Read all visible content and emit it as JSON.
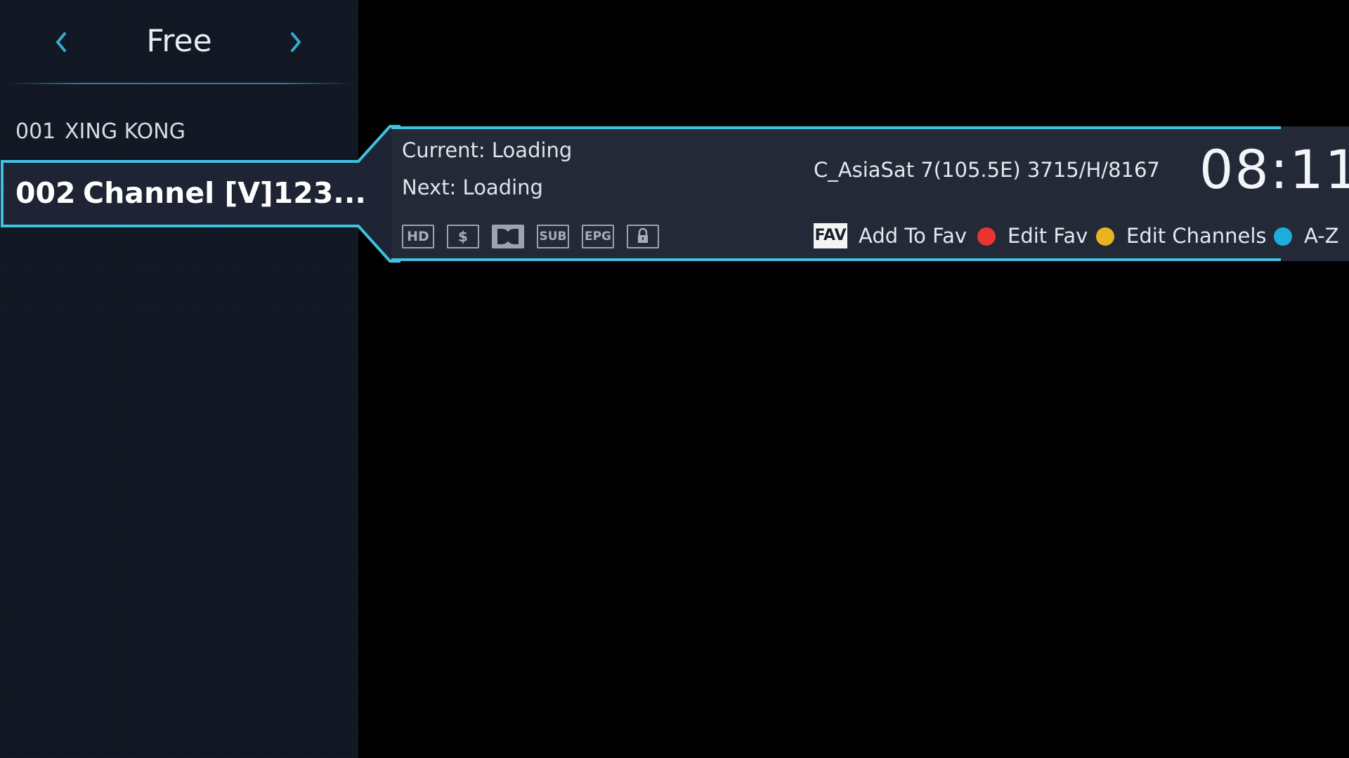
{
  "channel_list": {
    "group_title": "Free",
    "prev_icon": "chevron-left-icon",
    "next_icon": "chevron-right-icon",
    "channels": [
      {
        "number": "001",
        "name": "XING KONG"
      },
      {
        "number": "002",
        "name": "Channel [V]123..."
      }
    ],
    "selected_index": 1
  },
  "info_banner": {
    "current": "Current: Loading",
    "next": "Next: Loading",
    "satellite": "C_AsiaSat 7(105.5E) 3715/H/8167",
    "clock": "08:11",
    "badges": {
      "hd": "HD",
      "scrambled": "$",
      "dolby": "dolby-icon",
      "sub": "SUB",
      "epg": "EPG",
      "lock": "lock-icon"
    },
    "fav_chip": "FAV",
    "actions": [
      {
        "label": "Add To Fav",
        "color": "#ffffff"
      },
      {
        "label": "Edit Fav",
        "color": "#e8352f"
      },
      {
        "label": "Edit Channels",
        "color": "#e8b520"
      },
      {
        "label": "A-Z",
        "color": "#1eaedb"
      }
    ]
  },
  "colors": {
    "accent": "#3fc1e0",
    "panel": "#222836",
    "sidebar": "#111724",
    "red_key": "#e8352f",
    "yellow_key": "#e8b520",
    "blue_key": "#1eaedb"
  }
}
